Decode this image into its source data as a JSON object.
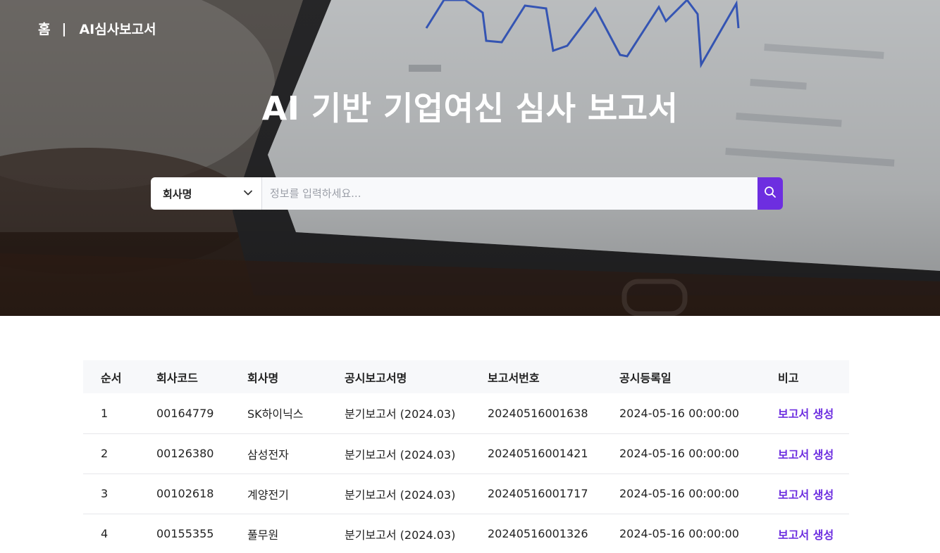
{
  "breadcrumb": {
    "home": "홈",
    "separator": "|",
    "current": "AI심사보고서"
  },
  "hero": {
    "title": "AI 기반 기업여신 심사 보고서"
  },
  "search": {
    "selected_option": "회사명",
    "placeholder": "정보를 입력하세요...",
    "value": ""
  },
  "table": {
    "headers": [
      "순서",
      "회사코드",
      "회사명",
      "공시보고서명",
      "보고서번호",
      "공시등록일",
      "비고"
    ],
    "rows": [
      [
        "1",
        "00164779",
        "SK하이닉스",
        "분기보고서 (2024.03)",
        "20240516001638",
        "2024-05-16 00:00:00",
        "보고서 생성"
      ],
      [
        "2",
        "00126380",
        "삼성전자",
        "분기보고서 (2024.03)",
        "20240516001421",
        "2024-05-16 00:00:00",
        "보고서 생성"
      ],
      [
        "3",
        "00102618",
        "계양전기",
        "분기보고서 (2024.03)",
        "20240516001717",
        "2024-05-16 00:00:00",
        "보고서 생성"
      ],
      [
        "4",
        "00155355",
        "풀무원",
        "분기보고서 (2024.03)",
        "20240516001326",
        "2024-05-16 00:00:00",
        "보고서 생성"
      ]
    ]
  },
  "colors": {
    "accent": "#6d2ee0",
    "header_bg": "#f7f8fa",
    "text": "#222222"
  },
  "icons": {
    "dropdown": "chevron-down-icon",
    "search": "search-icon"
  }
}
